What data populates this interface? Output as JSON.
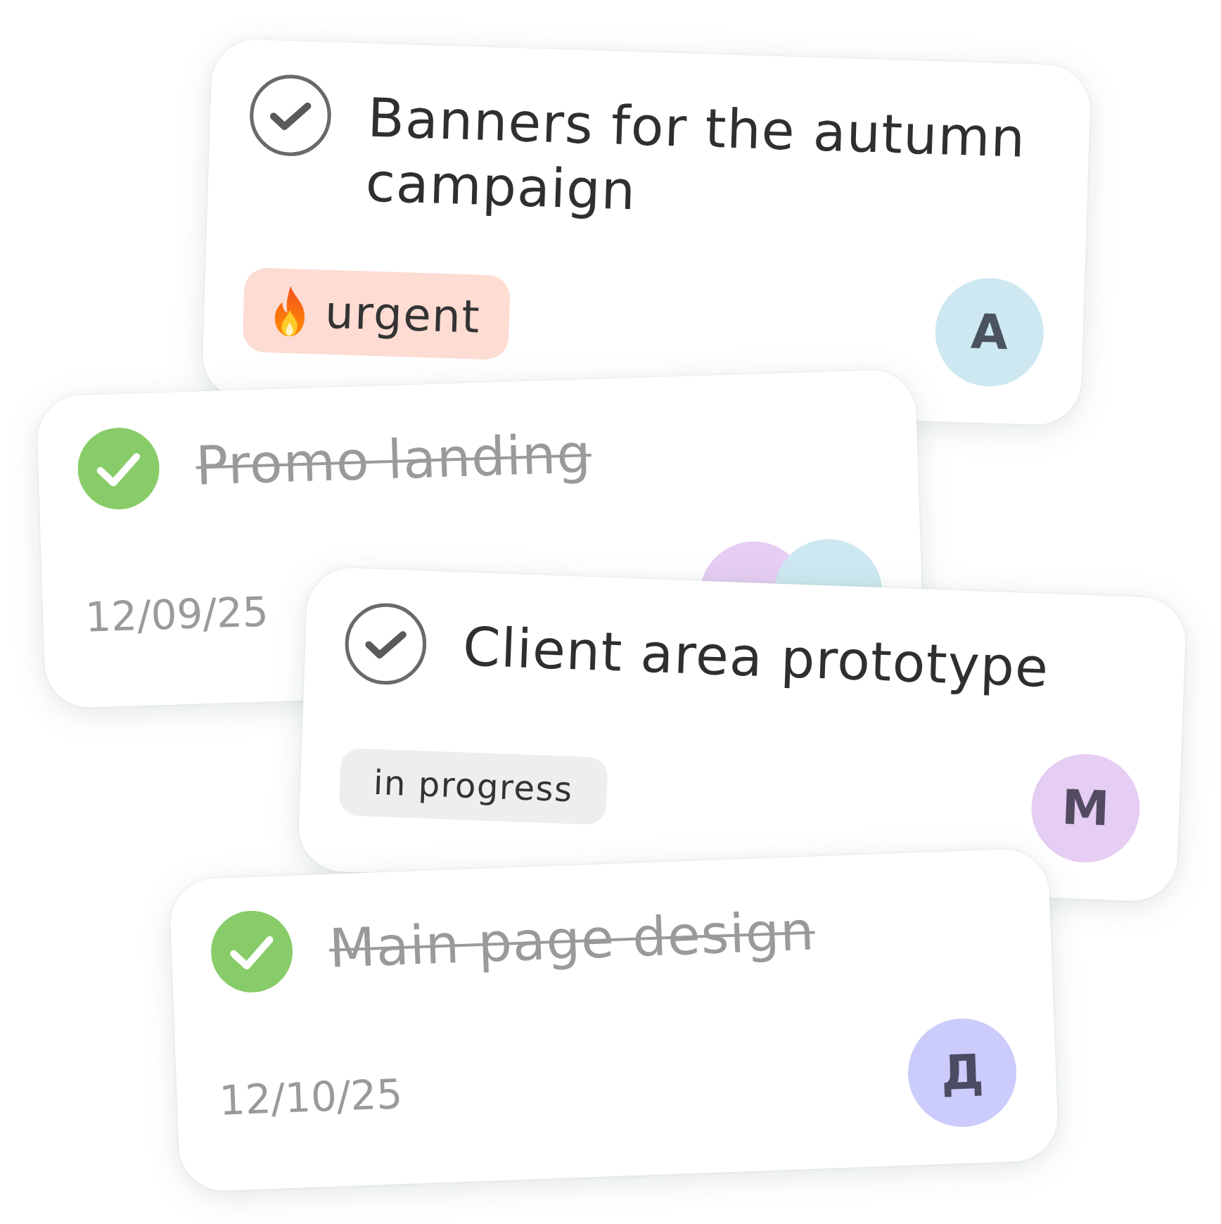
{
  "cards": [
    {
      "title": "Banners for the autumn campaign",
      "done": false,
      "tag": {
        "kind": "urgent",
        "label": "urgent"
      },
      "assignees": [
        {
          "initial": "A",
          "color": "#cde8f1"
        }
      ]
    },
    {
      "title": "Promo landing",
      "done": true,
      "date": "12/09/25",
      "assignees": [
        {
          "color": "#e6cdf3"
        },
        {
          "color": "#cde8f1"
        }
      ]
    },
    {
      "title": "Client area prototype",
      "done": false,
      "tag": {
        "kind": "status",
        "label": "in progress"
      },
      "assignees": [
        {
          "initial": "M",
          "color": "#e6cdf3"
        }
      ]
    },
    {
      "title": "Main page design",
      "done": true,
      "date": "12/10/25",
      "assignees": [
        {
          "initial": "Д",
          "color": "#cbcbfc"
        }
      ]
    }
  ]
}
